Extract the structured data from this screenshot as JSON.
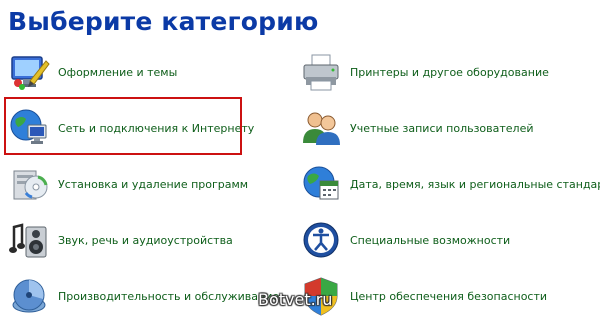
{
  "page_title": "Выберите категорию",
  "categories_left": [
    {
      "label": "Оформление и темы",
      "icon": "appearance-themes-icon"
    },
    {
      "label": "Сеть и подключения к Интернету",
      "icon": "network-internet-icon"
    },
    {
      "label": "Установка и удаление программ",
      "icon": "add-remove-programs-icon"
    },
    {
      "label": "Звук, речь и аудиоустройства",
      "icon": "sound-speech-audio-icon"
    },
    {
      "label": "Производительность и обслуживание",
      "icon": "performance-maintenance-icon"
    }
  ],
  "categories_right": [
    {
      "label": "Принтеры и другое оборудование",
      "icon": "printer-hardware-icon"
    },
    {
      "label": "Учетные записи пользователей",
      "icon": "user-accounts-icon"
    },
    {
      "label": "Дата, время, язык и региональные стандарты",
      "icon": "date-time-globe-icon"
    },
    {
      "label": "Специальные возможности",
      "icon": "accessibility-icon"
    },
    {
      "label": "Центр обеспечения безопасности",
      "icon": "security-center-shield-icon"
    }
  ],
  "highlighted_category": "Сеть и подключения к Интернету",
  "colors": {
    "title": "#0b3aa6",
    "label": "#0e5e1a",
    "highlight_border": "#cc1111"
  },
  "watermark": "Botvet.ru"
}
